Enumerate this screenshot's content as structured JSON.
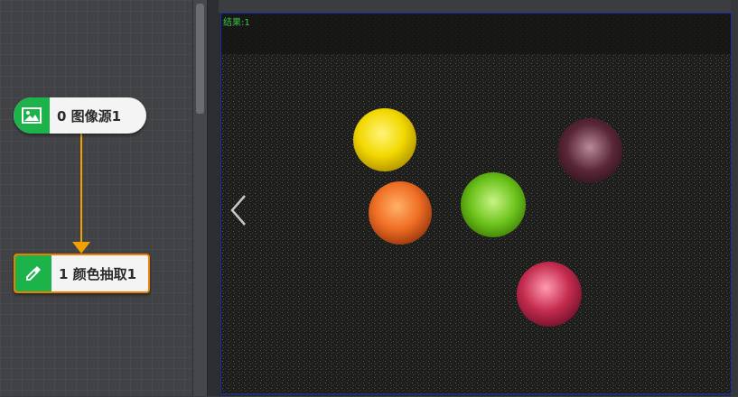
{
  "canvas": {
    "nodes": [
      {
        "label": "0 图像源1",
        "icon": "image-icon"
      },
      {
        "label": "1 颜色抽取1",
        "icon": "eyedropper-icon"
      }
    ]
  },
  "viewer": {
    "result_label": "结果:1"
  },
  "colors": {
    "node_green": "#1db34b",
    "connector": "#f2a100",
    "selected_border": "#ef7d00",
    "result_text": "#38c34a",
    "frame_border": "#1a2ea8"
  }
}
